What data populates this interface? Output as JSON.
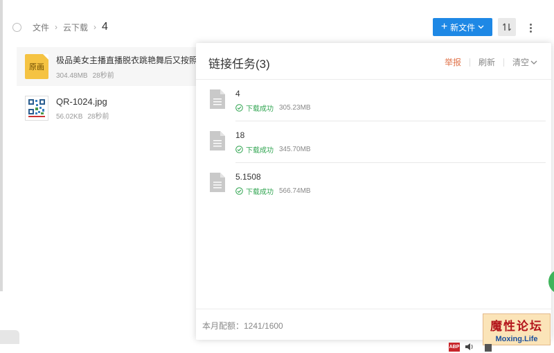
{
  "breadcrumb": {
    "items": [
      "文件",
      "云下载"
    ],
    "separator": "›",
    "current": "4"
  },
  "toolbar": {
    "new_file_label": "新文件",
    "new_file_color": "#1e88e5"
  },
  "files": [
    {
      "name": "极品美女主播直播脱衣跳艳舞后又按照",
      "thumb_label": "原画",
      "size": "304.48MB",
      "time": "28秒前"
    },
    {
      "name": "QR-1024.jpg",
      "size": "56.02KB",
      "time": "28秒前"
    }
  ],
  "panel": {
    "title": "链接任务(3)",
    "actions": {
      "report": "举报",
      "refresh": "刷新",
      "clear": "清空"
    },
    "tasks": [
      {
        "name": "4",
        "status": "下载成功",
        "size": "305.23MB"
      },
      {
        "name": "18",
        "status": "下载成功",
        "size": "345.70MB"
      },
      {
        "name": "5.1508",
        "status": "下载成功",
        "size": "566.74MB"
      }
    ],
    "quota": "本月配额：1241/1600"
  },
  "watermark": {
    "top": "魔性论坛",
    "bottom": "Moxing.Life"
  },
  "tray": {
    "abp": "ABP"
  },
  "colors": {
    "accent": "#1e88e5",
    "success": "#33a653",
    "report": "#e0734a"
  }
}
